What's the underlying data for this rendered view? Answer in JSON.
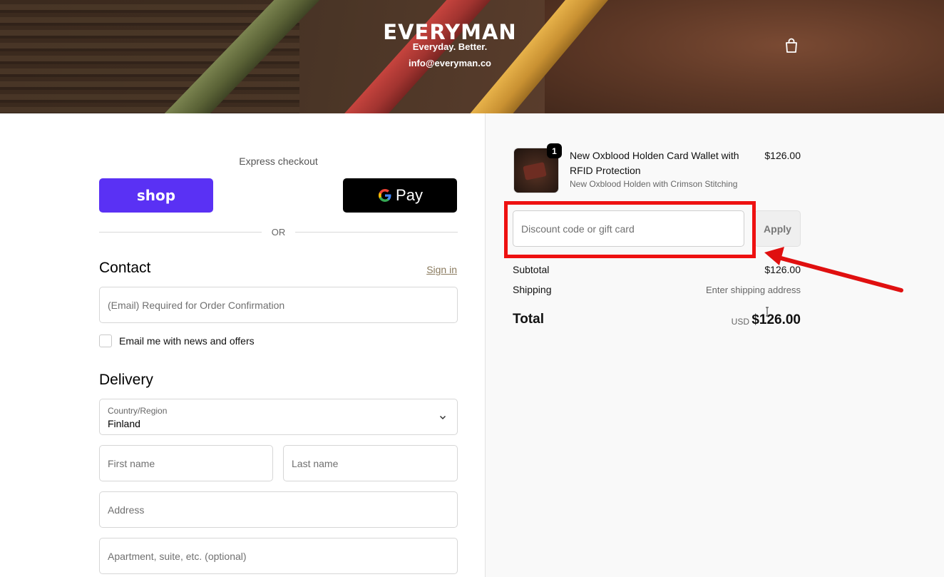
{
  "header": {
    "brand": "EVERYMAN",
    "tagline": "Everyday. Better.",
    "email": "info@everyman.co",
    "cart_icon": "shopping-bag-icon"
  },
  "express": {
    "label": "Express checkout",
    "shop_label": "shop",
    "gpay_label": "Pay",
    "divider": "OR"
  },
  "contact": {
    "title": "Contact",
    "signin": "Sign in",
    "email_placeholder": "(Email) Required for Order Confirmation",
    "news_label": "Email me with news and offers"
  },
  "delivery": {
    "title": "Delivery",
    "country_label": "Country/Region",
    "country_value": "Finland",
    "first_placeholder": "First name",
    "last_placeholder": "Last name",
    "address_placeholder": "Address",
    "apt_placeholder": "Apartment, suite, etc. (optional)"
  },
  "summary": {
    "item": {
      "quantity": "1",
      "name": "New Oxblood Holden Card Wallet with RFID Protection",
      "variant": "New Oxblood Holden with Crimson Stitching",
      "price": "$126.00"
    },
    "discount_placeholder": "Discount code or gift card",
    "apply_label": "Apply",
    "subtotal_label": "Subtotal",
    "subtotal_value": "$126.00",
    "shipping_label": "Shipping",
    "shipping_value": "Enter shipping address",
    "total_label": "Total",
    "currency": "USD",
    "total_value": "$126.00"
  },
  "colors": {
    "shop_purple": "#5a31f4",
    "highlight_red": "#ee1111",
    "signin_link": "#8a7a5e"
  }
}
